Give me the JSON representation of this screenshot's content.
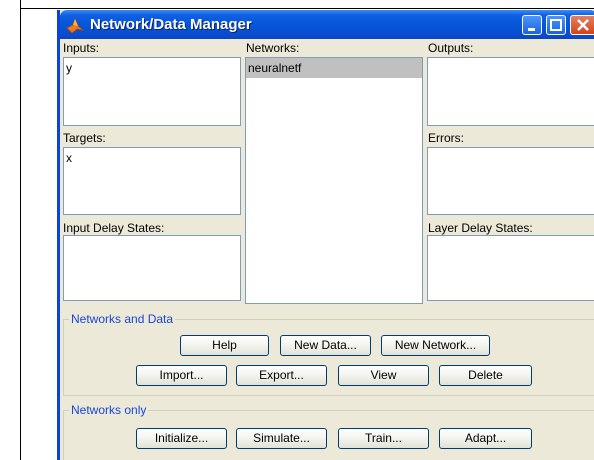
{
  "window": {
    "title": "Network/Data Manager"
  },
  "panels": {
    "inputs": {
      "label": "Inputs:",
      "items": [
        "y"
      ]
    },
    "networks": {
      "label": "Networks:",
      "items": [
        "neuralnetf"
      ]
    },
    "outputs": {
      "label": "Outputs:",
      "items": []
    },
    "targets": {
      "label": "Targets:",
      "items": [
        "x"
      ]
    },
    "errors": {
      "label": "Errors:",
      "items": []
    },
    "input_delay_states": {
      "label": "Input Delay States:",
      "items": []
    },
    "layer_delay_states": {
      "label": "Layer Delay States:",
      "items": []
    }
  },
  "networks_and_data": {
    "title": "Networks and Data",
    "buttons": {
      "help": "Help",
      "new_data": "New Data...",
      "new_network": "New Network...",
      "import": "Import...",
      "export": "Export...",
      "view": "View",
      "delete": "Delete"
    }
  },
  "networks_only": {
    "title": "Networks only",
    "buttons": {
      "initialize": "Initialize...",
      "simulate": "Simulate...",
      "train": "Train...",
      "adapt": "Adapt..."
    }
  },
  "colors": {
    "title_bar": "#0655d8",
    "window_bg": "#ece9d8",
    "group_title": "#1846d8",
    "selection": "#c0c0c0"
  }
}
